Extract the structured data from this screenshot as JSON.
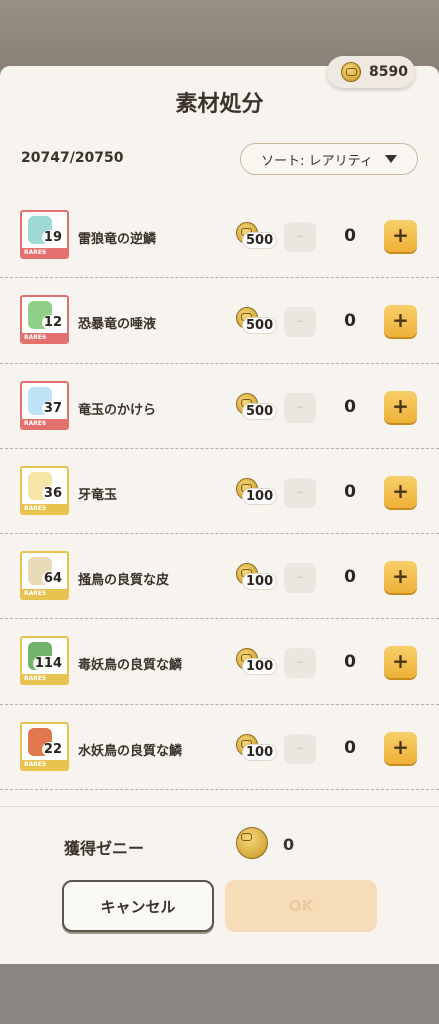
{
  "header": {
    "title": "素材処分",
    "zenny_balance": "8590"
  },
  "toolbar": {
    "count": "20747/20750",
    "sort_label": "ソート: レアリティ"
  },
  "items": [
    {
      "name": "雷狼竜の逆鱗",
      "qty": "19",
      "rarity": "RARE6",
      "price": "500",
      "selected": "0",
      "art_color": "#9fd9d5"
    },
    {
      "name": "恐暴竜の唾液",
      "qty": "12",
      "rarity": "RARE6",
      "price": "500",
      "selected": "0",
      "art_color": "#8fcf88"
    },
    {
      "name": "竜玉のかけら",
      "qty": "37",
      "rarity": "RARE6",
      "price": "500",
      "selected": "0",
      "art_color": "#bfe3f5"
    },
    {
      "name": "牙竜玉",
      "qty": "36",
      "rarity": "RARE5",
      "price": "100",
      "selected": "0",
      "art_color": "#f5e6a8"
    },
    {
      "name": "掻鳥の良質な皮",
      "qty": "64",
      "rarity": "RARE5",
      "price": "100",
      "selected": "0",
      "art_color": "#e8dbb8"
    },
    {
      "name": "毒妖鳥の良質な鱗",
      "qty": "114",
      "rarity": "RARE5",
      "price": "100",
      "selected": "0",
      "art_color": "#6fb46a"
    },
    {
      "name": "水妖鳥の良質な鱗",
      "qty": "22",
      "rarity": "RARE5",
      "price": "100",
      "selected": "0",
      "art_color": "#e0774f"
    }
  ],
  "controls": {
    "minus": "-",
    "plus": "+"
  },
  "footer": {
    "label": "獲得ゼニー",
    "amount": "0",
    "cancel_label": "キャンセル",
    "ok_label": "OK"
  }
}
